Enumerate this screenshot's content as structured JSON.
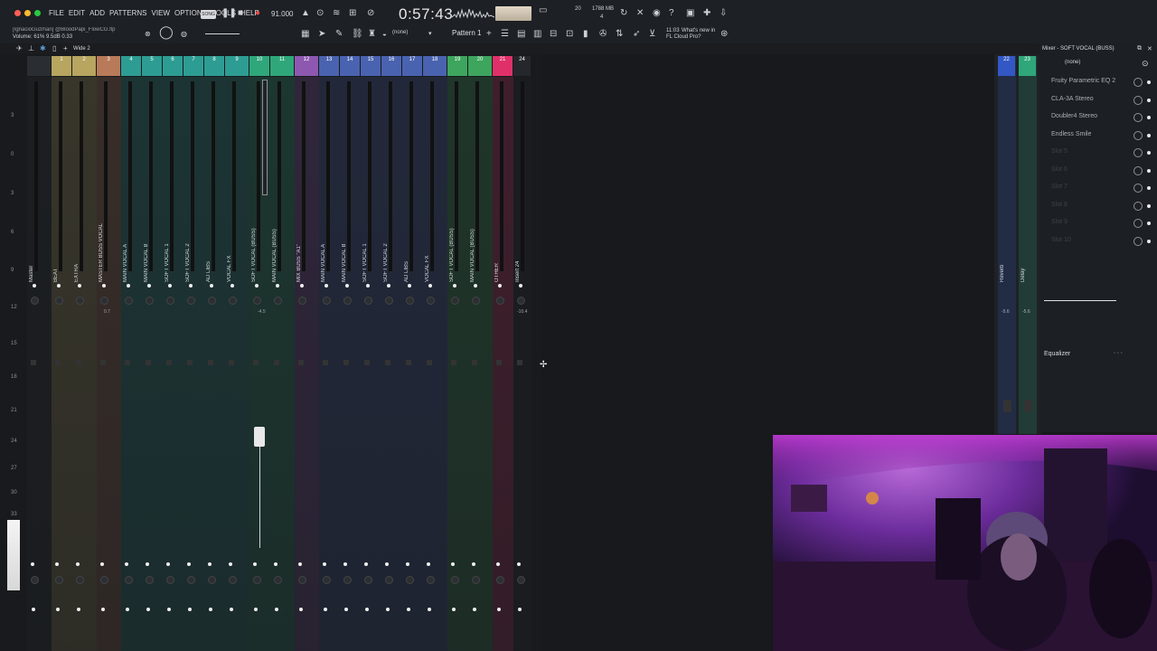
{
  "topbar": {
    "menu": [
      "FILE",
      "EDIT",
      "ADD",
      "PATTERNS",
      "VIEW",
      "OPTIONS",
      "TOOLS",
      "HELP"
    ],
    "song_badge": "SONG",
    "tempo": "91.000",
    "time": "0:57:43",
    "cpu_poly": "20",
    "memory": "1788 MB",
    "mem_sub": "4",
    "pattern_label": "Pattern 1",
    "none_label": "(none)",
    "news_time": "11:03",
    "news_text": "What's new in",
    "news_text2": "FL Cloud Pro?",
    "user_line": "[IgnacioGuzman] @BloodPapi_FlowCG.flp",
    "volume_line": "Volume: 61%  9.5dB  0.33",
    "wide_label": "Wide 2"
  },
  "mixer": {
    "channels": [
      {
        "num": "",
        "label": "Master",
        "color": "#2a2e33"
      },
      {
        "num": "1",
        "label": "BEAT",
        "color": "#b7a560"
      },
      {
        "num": "2",
        "label": "EXTRA",
        "color": "#b7a560"
      },
      {
        "num": "3",
        "label": "MASTER BUSS VOCAL",
        "color": "#b87a58"
      },
      {
        "num": "4",
        "label": "MAIN VOCAL A",
        "color": "#2d9d93"
      },
      {
        "num": "5",
        "label": "MAIN VOCAL B",
        "color": "#2d9d93"
      },
      {
        "num": "6",
        "label": "SOFT VOCAL 1",
        "color": "#2d9d93"
      },
      {
        "num": "7",
        "label": "SOFT VOCAL 2",
        "color": "#2d9d93"
      },
      {
        "num": "8",
        "label": "AD LIBS",
        "color": "#2d9d93"
      },
      {
        "num": "9",
        "label": "VOCAL FX",
        "color": "#2d9d93"
      },
      {
        "num": "10",
        "label": "SOFT VOCAL (BUSS)",
        "color": "#2fa77a"
      },
      {
        "num": "11",
        "label": "MAIN VOCAL (BUSS)",
        "color": "#2fa77a"
      },
      {
        "num": "12",
        "label": "MIX BUSS \"A1\"",
        "color": "#8e58b0"
      },
      {
        "num": "13",
        "label": "MAIN VOCAL A",
        "color": "#4a63b0"
      },
      {
        "num": "14",
        "label": "MAIN VOCAL B",
        "color": "#4a63b0"
      },
      {
        "num": "15",
        "label": "SOFT VOCAL 1",
        "color": "#4a63b0"
      },
      {
        "num": "16",
        "label": "SOFT VOCAL 2",
        "color": "#4a63b0"
      },
      {
        "num": "17",
        "label": "AD LIBS",
        "color": "#4a63b0"
      },
      {
        "num": "18",
        "label": "VOCAL FX",
        "color": "#4a63b0"
      },
      {
        "num": "19",
        "label": "SOFT VOCAL (BUSS)",
        "color": "#3da55d"
      },
      {
        "num": "20",
        "label": "MAIN VOCAL (BUSS)",
        "color": "#3da55d"
      },
      {
        "num": "21",
        "label": "OTHER",
        "color": "#e0306a"
      },
      {
        "num": "24",
        "label": "Insert 24",
        "color": "#24272b"
      }
    ],
    "scale": [
      "3",
      "0",
      "3",
      "6",
      "9",
      "12",
      "15",
      "18",
      "21",
      "24",
      "27",
      "30",
      "33"
    ],
    "vol_readouts": {
      "master_buss": "0.7",
      "soft_buss": "-4.5",
      "insert24": "-10.4"
    },
    "right_channels": [
      {
        "num": "22",
        "label": "Reverb",
        "color": "#3357c4",
        "vol": "-5.6"
      },
      {
        "num": "23",
        "label": "Delay",
        "color": "#2fa77a",
        "vol": "-5.6"
      }
    ]
  },
  "fx_panel": {
    "title": "Mixer - SOFT VOCAL (BUSS)",
    "input": "(none)",
    "slots": [
      "Fruity Parametric EQ 2",
      "CLA-3A Stereo",
      "Doubler4 Stereo",
      "Endless Smile",
      "Slot 5",
      "Slot 6",
      "Slot 7",
      "Slot 8",
      "Slot 9",
      "Slot 10"
    ],
    "slots_active": [
      true,
      true,
      true,
      true,
      false,
      false,
      false,
      false,
      false,
      false
    ],
    "eq_label": "Equalizer"
  }
}
